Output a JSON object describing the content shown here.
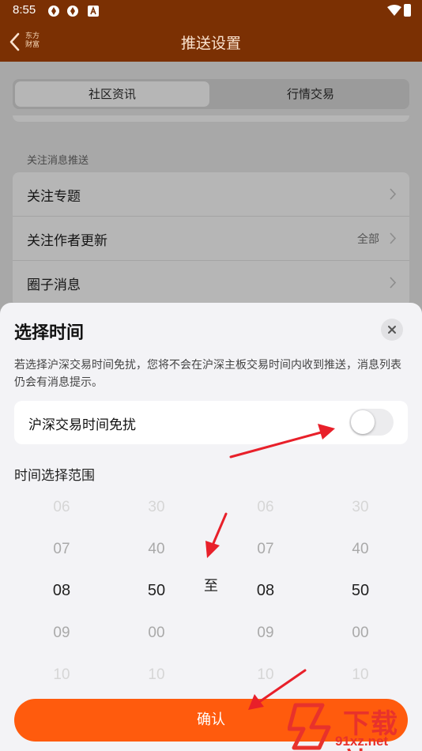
{
  "status_bar": {
    "time": "8:55"
  },
  "nav": {
    "title": "推送设置",
    "logo_text": "东方财富"
  },
  "tabs": [
    {
      "label": "社区资讯",
      "active": true
    },
    {
      "label": "行情交易",
      "active": false
    }
  ],
  "section": {
    "label": "关注消息推送"
  },
  "list_items": [
    {
      "label": "关注专题",
      "value": ""
    },
    {
      "label": "关注作者更新",
      "value": "全部"
    },
    {
      "label": "圈子消息",
      "value": ""
    }
  ],
  "sheet": {
    "title": "选择时间",
    "description": "若选择沪深交易时间免扰，您将不会在沪深主板交易时间内收到推送，消息列表仍会有消息提示。",
    "toggle_label": "沪深交易时间免扰",
    "toggle_on": false,
    "range_label": "时间选择范围",
    "separator": "至",
    "confirm_label": "确认"
  },
  "picker": {
    "start_hour": [
      "06",
      "07",
      "08",
      "09",
      "10"
    ],
    "start_minute": [
      "30",
      "40",
      "50",
      "00",
      "10"
    ],
    "end_hour": [
      "06",
      "07",
      "08",
      "09",
      "10"
    ],
    "end_minute": [
      "30",
      "40",
      "50",
      "00",
      "10"
    ]
  },
  "watermark": {
    "main": "下载站",
    "sub": "91xz.net"
  },
  "colors": {
    "nav_bg": "#7b3003",
    "accent": "#ff5b0d",
    "annotation_arrow": "#e8202a"
  }
}
